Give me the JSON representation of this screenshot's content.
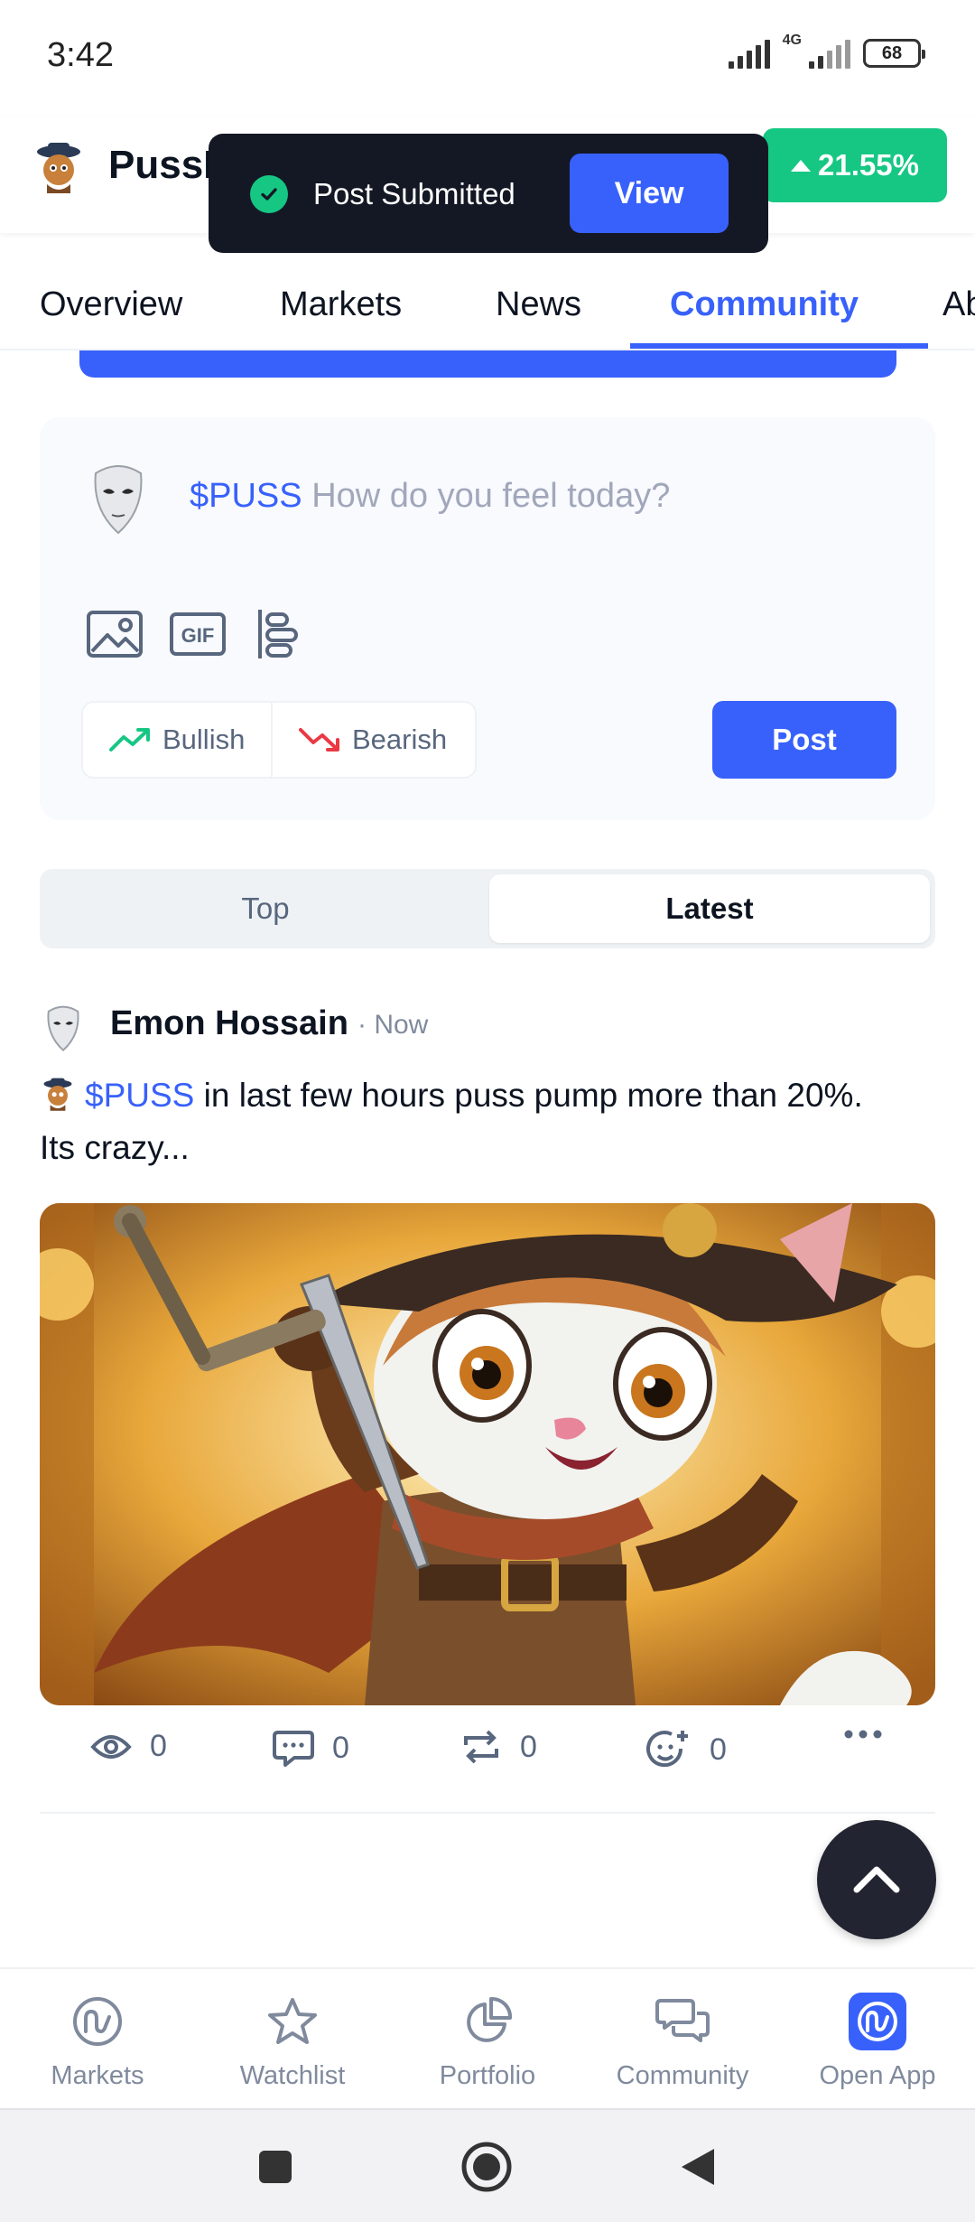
{
  "status_bar": {
    "time": "3:42",
    "network": "4G",
    "battery": "68"
  },
  "header": {
    "coin_name": "PussF",
    "change": "21.55%",
    "accent": "#16c784"
  },
  "toast": {
    "message": "Post Submitted",
    "action_label": "View"
  },
  "tabs": [
    {
      "label": "Overview"
    },
    {
      "label": "Markets"
    },
    {
      "label": "News"
    },
    {
      "label": "Community",
      "active": true
    },
    {
      "label": "Ab"
    }
  ],
  "composer": {
    "ticker": "$PUSS",
    "placeholder": "How do you feel today?",
    "tools": [
      "image-icon",
      "gif-icon",
      "poll-icon"
    ],
    "bullish_label": "Bullish",
    "bearish_label": "Bearish",
    "post_label": "Post"
  },
  "feed_toggle": {
    "top": "Top",
    "latest": "Latest",
    "selected": "Latest"
  },
  "post": {
    "author": "Emon Hossain",
    "time": "· Now",
    "ticker": "$PUSS",
    "text": " in last few hours puss pump more than 20%. Its crazy...",
    "views": "0",
    "comments": "0",
    "reposts": "0",
    "reactions": "0"
  },
  "bottom_nav": [
    {
      "label": "Markets",
      "icon": "markets-icon"
    },
    {
      "label": "Watchlist",
      "icon": "star-icon"
    },
    {
      "label": "Portfolio",
      "icon": "pie-chart-icon"
    },
    {
      "label": "Community",
      "icon": "chat-icon"
    },
    {
      "label": "Open App",
      "icon": "app-logo-icon"
    }
  ],
  "colors": {
    "brand": "#3861fb",
    "positive": "#16c784",
    "negative": "#ea3943"
  }
}
